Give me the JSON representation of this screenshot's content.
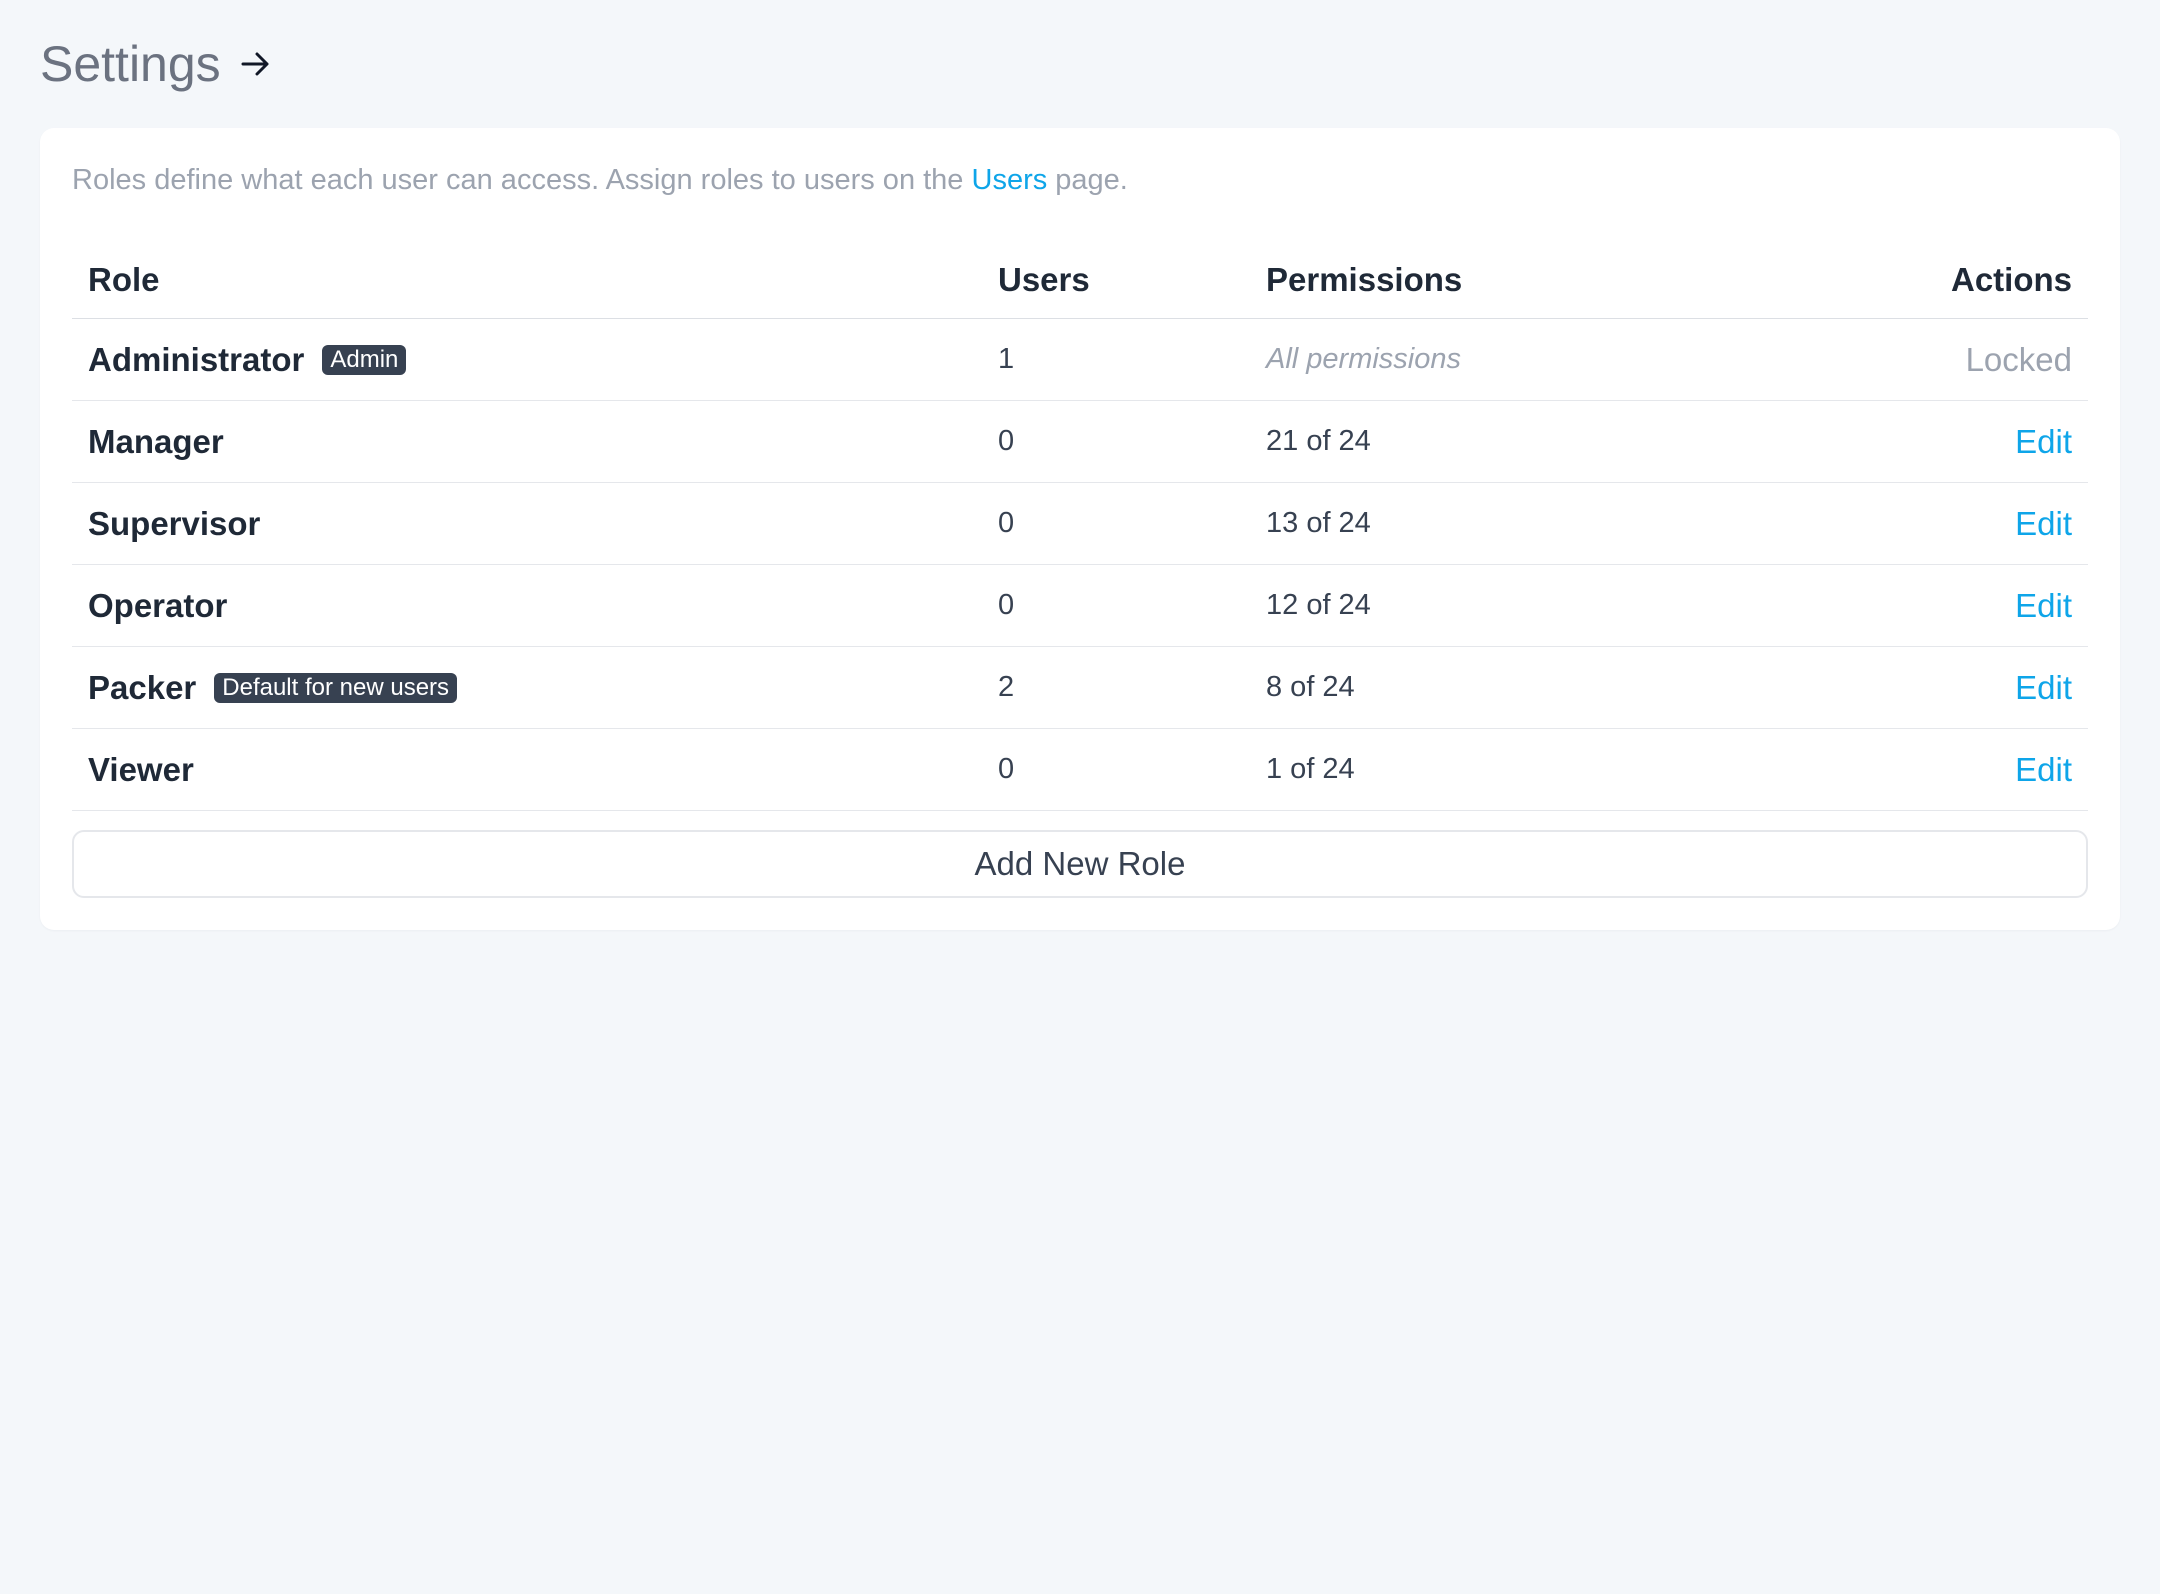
{
  "header": {
    "title": "Settings",
    "arrow_icon": "arrow-right-icon"
  },
  "card": {
    "description_before": "Roles define what each user can access. Assign roles to users on the ",
    "description_link": "Users",
    "description_after": " page."
  },
  "table": {
    "columns": {
      "role": "Role",
      "users": "Users",
      "permissions": "Permissions",
      "actions": "Actions"
    },
    "rows": [
      {
        "name": "Administrator",
        "badge": "Admin",
        "users": "1",
        "permissions": "All permissions",
        "action": "Locked"
      },
      {
        "name": "Manager",
        "badge": "",
        "users": "0",
        "permissions": "21 of 24",
        "action": "Edit"
      },
      {
        "name": "Supervisor",
        "badge": "",
        "users": "0",
        "permissions": "13 of 24",
        "action": "Edit"
      },
      {
        "name": "Operator",
        "badge": "",
        "users": "0",
        "permissions": "12 of 24",
        "action": "Edit"
      },
      {
        "name": "Packer",
        "badge": "Default for new users",
        "users": "2",
        "permissions": "8 of 24",
        "action": "Edit"
      },
      {
        "name": "Viewer",
        "badge": "",
        "users": "0",
        "permissions": "1 of 24",
        "action": "Edit"
      }
    ]
  },
  "add_button": {
    "label": "Add New Role"
  },
  "colors": {
    "accent": "#0ea5e9",
    "badge_bg": "#374151",
    "background": "#f4f7fa"
  }
}
